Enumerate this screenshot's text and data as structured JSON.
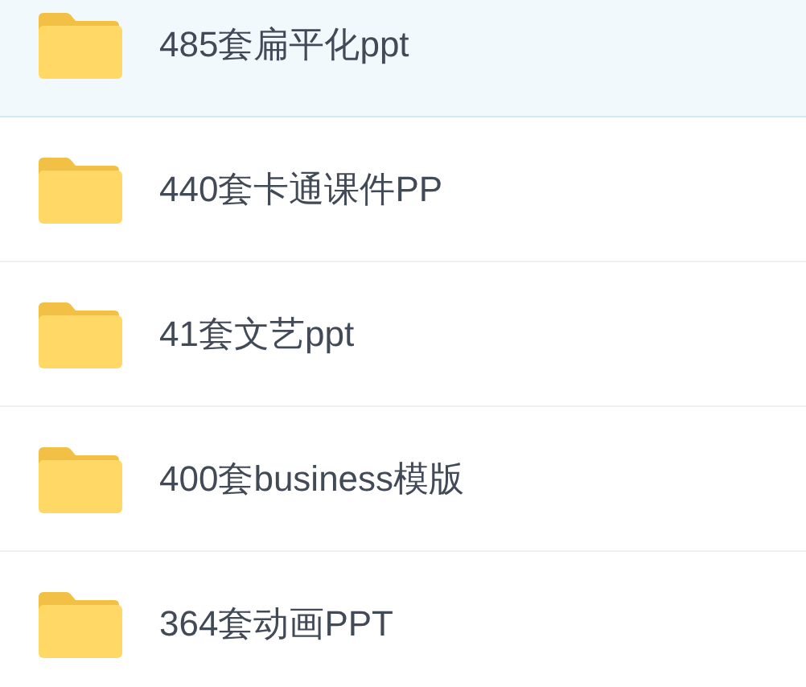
{
  "folders": [
    {
      "name": "485套扁平化ppt",
      "selected": true
    },
    {
      "name": "440套卡通课件PP",
      "selected": false
    },
    {
      "name": "41套文艺ppt",
      "selected": false
    },
    {
      "name": "400套business模版",
      "selected": false
    },
    {
      "name": "364套动画PPT",
      "selected": false
    }
  ]
}
